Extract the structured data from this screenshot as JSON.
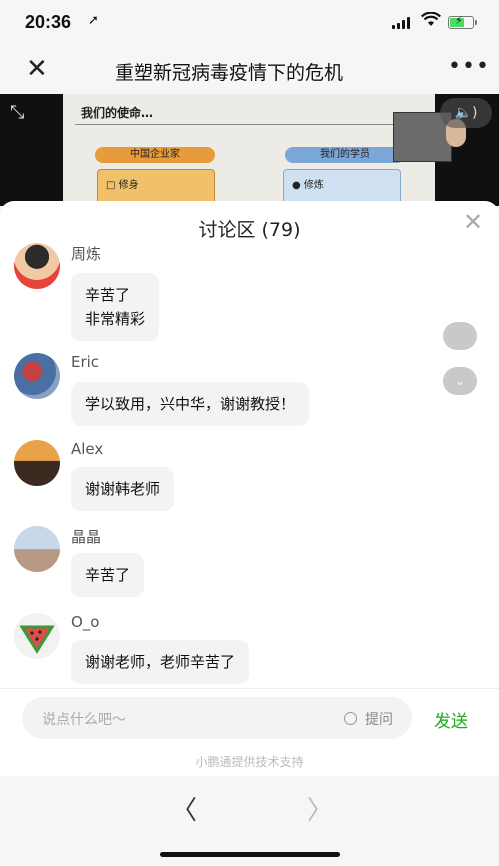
{
  "status": {
    "time": "20:36"
  },
  "nav": {
    "title": "重塑新冠病毒疫情下的危机",
    "close_icon": "close-icon",
    "more_icon": "more-icon"
  },
  "slide": {
    "heading": "我们的使命…",
    "left_pill": "中国企业家",
    "right_pill": "我们的学员",
    "left_item": "□ 修身",
    "right_item": "● 修炼"
  },
  "discussion": {
    "title": "讨论区 (79)",
    "messages": [
      {
        "name": "周炼",
        "lines": [
          "辛苦了",
          "非常精彩"
        ]
      },
      {
        "name": "Eric",
        "lines": [
          "学以致用，兴中华，谢谢教授！"
        ]
      },
      {
        "name": "Alex",
        "lines": [
          "谢谢韩老师"
        ]
      },
      {
        "name": "晶晶",
        "lines": [
          "辛苦了"
        ]
      },
      {
        "name": "O_o",
        "lines": [
          "谢谢老师，老师辛苦了"
        ]
      }
    ]
  },
  "input": {
    "placeholder": "说点什么吧～",
    "ask_label": "提问",
    "send_label": "发送"
  },
  "footer": {
    "text": "小鹏通提供技术支持"
  },
  "colors": {
    "send": "#1aad19",
    "bubble": "#f3f3f3"
  }
}
